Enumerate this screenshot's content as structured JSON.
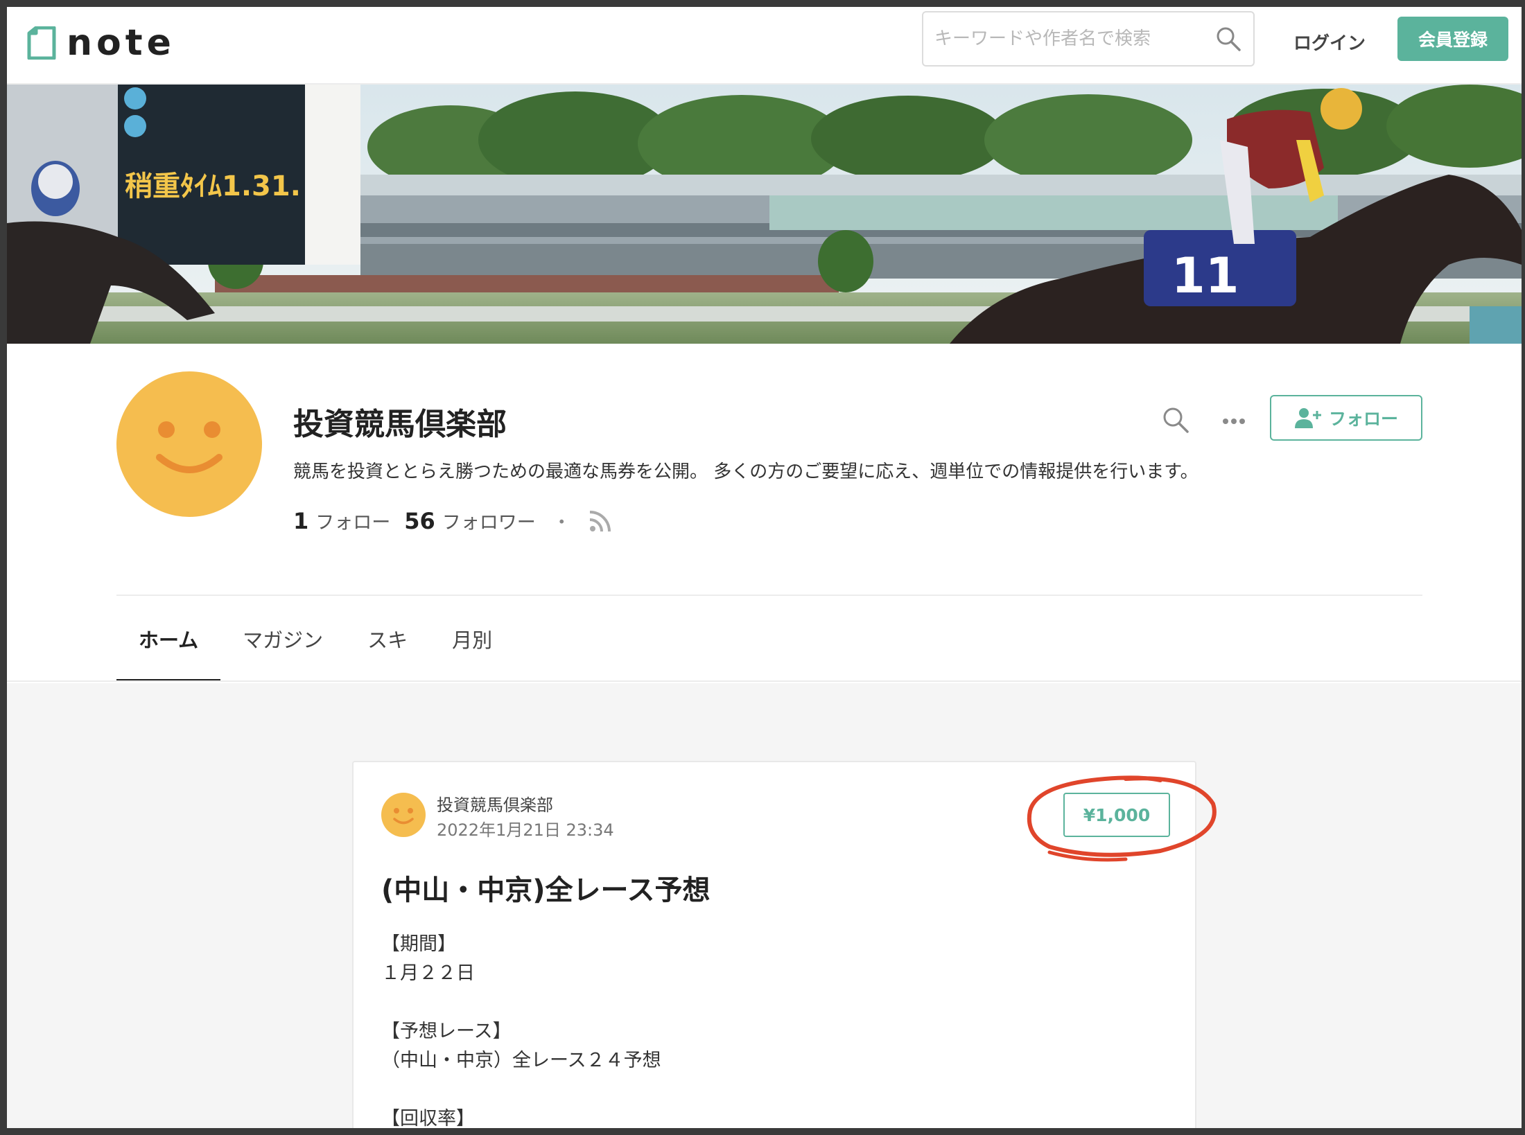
{
  "header": {
    "logo_text": "note",
    "search_placeholder": "キーワードや作者名で検索",
    "login_label": "ログイン",
    "signup_label": "会員登録"
  },
  "profile": {
    "name": "投資競馬倶楽部",
    "bio": "競馬を投資ととらえ勝つための最適な馬券を公開。 多くの方のご要望に応え、週単位での情報提供を行います。",
    "follow_count": "1",
    "follow_label": "フォロー",
    "follower_count": "56",
    "follower_label": "フォロワー",
    "separator": "・",
    "follow_button": "フォロー"
  },
  "tabs": [
    {
      "label": "ホーム",
      "active": true
    },
    {
      "label": "マガジン",
      "active": false
    },
    {
      "label": "スキ",
      "active": false
    },
    {
      "label": "月別",
      "active": false
    }
  ],
  "article": {
    "author": "投資競馬倶楽部",
    "date": "2022年1月21日 23:34",
    "price": "¥1,000",
    "title": "(中山・中京)全レース予想",
    "body": [
      {
        "heading": "【期間】",
        "text": "１月２２日"
      },
      {
        "heading": "【予想レース】",
        "text": "（中山・中京）全レース２４予想"
      },
      {
        "heading": "【回収率】",
        "text": ""
      }
    ]
  },
  "colors": {
    "accent": "#5bb39c",
    "avatar": "#f5bd4f",
    "annotation": "#e0452b"
  }
}
